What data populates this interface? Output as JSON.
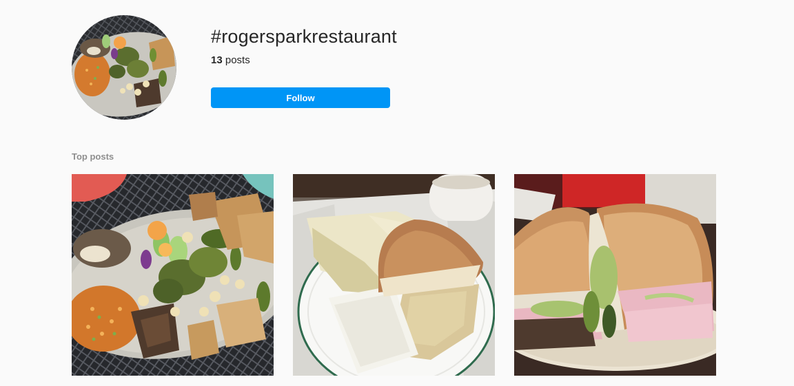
{
  "header": {
    "hashtag": "#rogersparkrestaurant",
    "post_count": "13",
    "post_count_suffix": " posts",
    "follow_label": "Follow"
  },
  "sections": {
    "top_posts_title": "Top posts"
  },
  "images": {
    "profile": "food platter (rice, beans, cactus, peppers) on a metal mesh table",
    "posts": [
      "large food platter on a black metal mesh table",
      "tamales and a bread roll on a white plate with a cup",
      "halved torta sandwich with ham on a plate"
    ]
  },
  "colors": {
    "accent": "#0095f6",
    "background": "#fafafa",
    "text": "#262626",
    "muted": "#8e8e8e"
  }
}
